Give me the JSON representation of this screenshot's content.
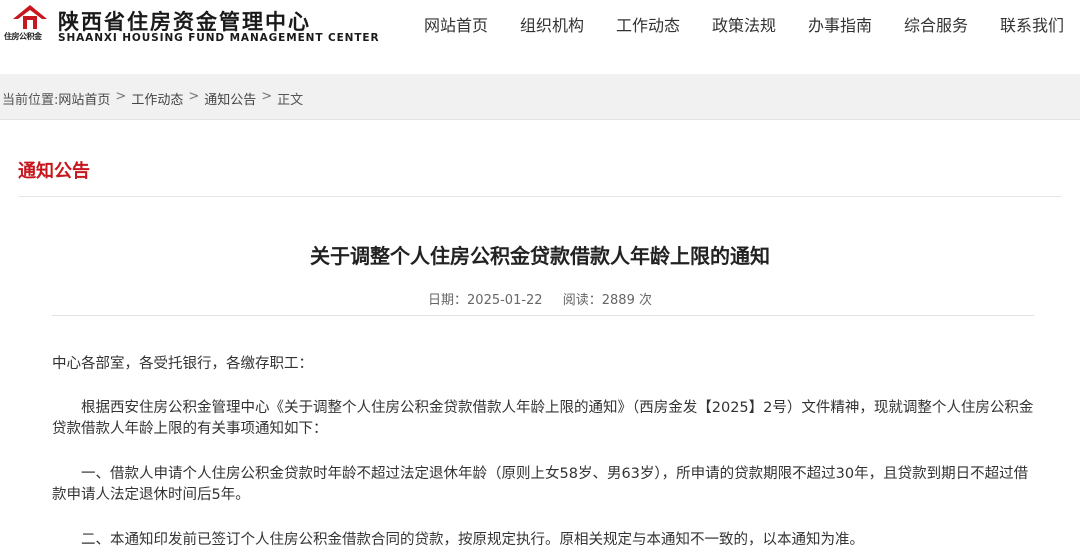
{
  "site": {
    "logo_emblem_text": "住房公积金",
    "title": "陕西省住房资金管理中心",
    "subtitle": "SHAANXI HOUSING FUND MANAGEMENT CENTER",
    "brand_color": "#c7161d"
  },
  "nav": {
    "items": [
      {
        "label": "网站首页"
      },
      {
        "label": "组织机构"
      },
      {
        "label": "工作动态"
      },
      {
        "label": "政策法规"
      },
      {
        "label": "办事指南"
      },
      {
        "label": "综合服务"
      },
      {
        "label": "联系我们"
      }
    ]
  },
  "breadcrumb": {
    "prefix": "当前位置:",
    "items": [
      "网站首页",
      "工作动态",
      "通知公告",
      "正文"
    ],
    "separator": ">"
  },
  "section": {
    "title": "通知公告"
  },
  "article": {
    "title": "关于调整个人住房公积金贷款借款人年龄上限的通知",
    "date_label": "日期：",
    "date": "2025-01-22",
    "views_label": "阅读：",
    "views": "2889 次",
    "paragraphs": [
      "中心各部室，各受托银行，各缴存职工：",
      "根据西安住房公积金管理中心《关于调整个人住房公积金贷款借款人年龄上限的通知》（西房金发【2025】2号）文件精神，现就调整个人住房公积金贷款借款人年龄上限的有关事项通知如下：",
      "一、借款人申请个人住房公积金贷款时年龄不超过法定退休年龄（原则上女58岁、男63岁），所申请的贷款期限不超过30年，且贷款到期日不超过借款申请人法定退休时间后5年。",
      "二、本通知印发前已签订个人住房公积金借款合同的贷款，按原规定执行。原相关规定与本通知不一致的，以本通知为准。"
    ]
  }
}
